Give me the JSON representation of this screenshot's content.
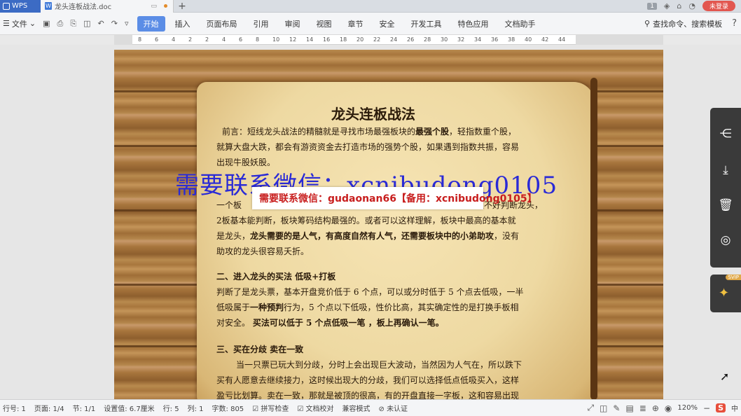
{
  "titlebar": {
    "app_tab": "WPS",
    "doc_tab": "龙头连板战法.doc",
    "badge": "1",
    "login": "未登录"
  },
  "menu": {
    "file": "文件",
    "items": [
      "开始",
      "插入",
      "页面布局",
      "引用",
      "审阅",
      "视图",
      "章节",
      "安全",
      "开发工具",
      "特色应用",
      "文档助手"
    ],
    "active_index": 0,
    "search_cmd": "查找命令、搜索模板",
    "help": "?"
  },
  "ruler": {
    "ticks": [
      "8",
      "6",
      "4",
      "2",
      "2",
      "4",
      "6",
      "8",
      "10",
      "12",
      "14",
      "16",
      "18",
      "20",
      "22",
      "24",
      "26",
      "28",
      "30",
      "32",
      "34",
      "36",
      "38",
      "40",
      "42",
      "44"
    ]
  },
  "document": {
    "title": "龙头连板战法",
    "p1a": "前言：短线龙头战法的精髓就是寻找市场最强板块的",
    "p1b": "最强个股",
    "p1c": "，轻指数重个股，",
    "p1d": "就算大盘大跌，都会有游资资金去打造市场的强势个股，如果遇到指数共振，容易",
    "p1e": "出现牛股妖股。",
    "p2a": "一个板",
    "p2b": "板不好判断龙头，",
    "p2c": "2板基本能判断，板块筹码结构最强的。或者可以这样理解，板块中最高的基本就",
    "p2d": "是龙头，",
    "p2e": "龙头需要的是人气，有高度自然有人气，还需要板块中的小弟助攻",
    "p2f": "，没有",
    "p2g": "助攻的龙头很容易夭折。",
    "h2": "二、进入龙头的买法     低吸+打板",
    "p3a": "判断了是龙头票，基本开盘竞价低于 6 个点，可以或分时低于 5 个点去低吸，一半",
    "p3b": "低吸属于",
    "p3c": "一种预判",
    "p3d": "行为，5 个点以下低吸，性价比高，其实确定性的是打换手板相",
    "p3e": "对安全。    ",
    "p3f": "买法可以低于 5 个点低吸一笔  ，板上再确认一笔。",
    "h3": "三、买在分歧  卖在一致",
    "p4a": "当一只票已玩大到分歧，分时上会出现巨大波动，当然因为人气在，所以跌下",
    "p4b": "买有人愿意去继续接力，这时候出现大的分歧，我们可以选择低点低吸买入，这样",
    "p4c": "盈亏比划算。卖在一致，那就是被顶的很高，有的开盘直接一字板，这和容易出现"
  },
  "watermark": {
    "big": "需要联系微信：xcnibudong0105",
    "box": "需要联系微信：gudaonan66【备用：xcnibudong0105】"
  },
  "statusbar": {
    "line": "行号: 1",
    "pages": "页面: 1/4",
    "section": "节: 1/1",
    "setting": "设置值: 6.7厘米",
    "row": "行: 5",
    "col": "列: 1",
    "words": "字数: 805",
    "spell": "拼写检查",
    "proof": "文档校对",
    "mode": "兼容模式",
    "cert": "未认证",
    "zoom": "120%",
    "ime": "中"
  },
  "sidepanel": {
    "svip": "SVIP"
  }
}
